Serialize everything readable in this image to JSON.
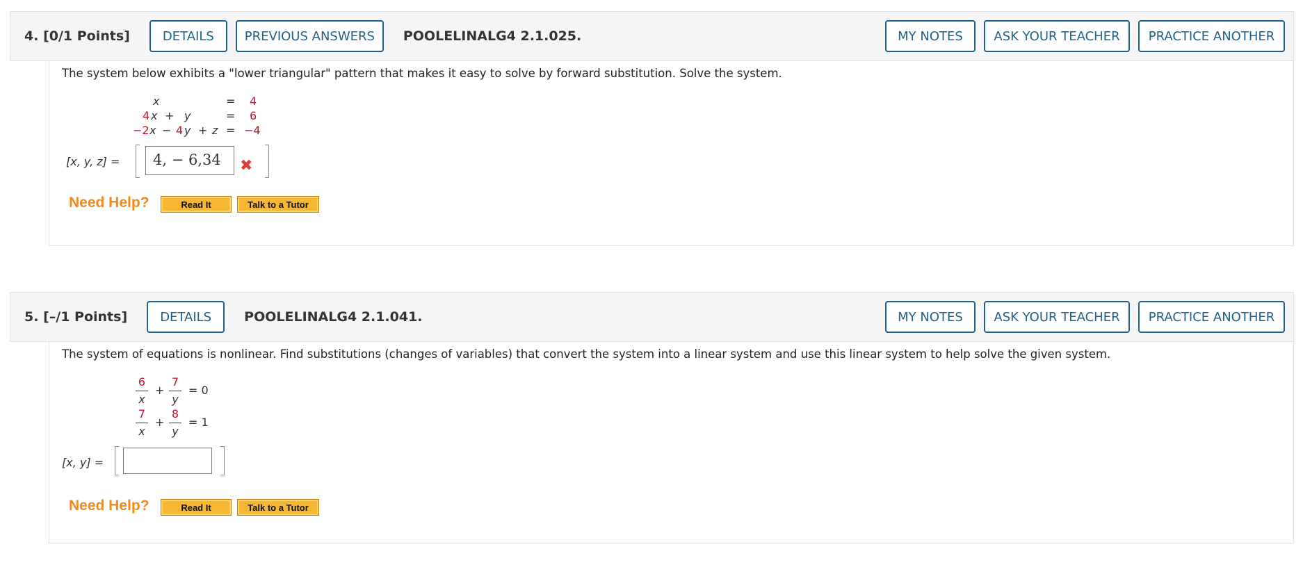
{
  "q4": {
    "number": "4.",
    "points": "[0/1 Points]",
    "details_label": "DETAILS",
    "previous_answers_label": "PREVIOUS ANSWERS",
    "code": "POOLELINALG4 2.1.025.",
    "my_notes_label": "MY NOTES",
    "ask_teacher_label": "ASK YOUR TEACHER",
    "practice_another_label": "PRACTICE ANOTHER",
    "prompt": "The system below exhibits a \"lower triangular\" pattern that makes it easy to solve by forward substitution. Solve the system.",
    "eq": {
      "r1_x": "x",
      "r1_eq": "=",
      "r1_rhs": "4",
      "r2_coef_x": "4",
      "r2_x": "x",
      "r2_plus": "+",
      "r2_y": "y",
      "r2_eq": "=",
      "r2_rhs": "6",
      "r3_coef_x": "−2",
      "r3_x": "x",
      "r3_minus": "−",
      "r3_coef_y": "4",
      "r3_y": "y",
      "r3_plus": "+",
      "r3_z": "z",
      "r3_eq": "=",
      "r3_rhs": "−4"
    },
    "answer_label": "[x, y, z] =",
    "answer_value": "4, − 6,34",
    "answer_status": "incorrect",
    "need_help_label": "Need Help?",
    "read_it_label": "Read It",
    "talk_tutor_label": "Talk to a Tutor"
  },
  "q5": {
    "number": "5.",
    "points": "[–/1 Points]",
    "details_label": "DETAILS",
    "code": "POOLELINALG4 2.1.041.",
    "my_notes_label": "MY NOTES",
    "ask_teacher_label": "ASK YOUR TEACHER",
    "practice_another_label": "PRACTICE ANOTHER",
    "prompt": "The system of equations is nonlinear. Find substitutions (changes of variables) that convert the system into a linear system and use this linear system to help solve the given system.",
    "eq": {
      "r1_num1": "6",
      "r1_den1": "x",
      "r1_plus": "+",
      "r1_num2": "7",
      "r1_den2": "y",
      "r1_eq": "= 0",
      "r2_num1": "7",
      "r2_den1": "x",
      "r2_plus": "+",
      "r2_num2": "8",
      "r2_den2": "y",
      "r2_eq": "= 1"
    },
    "answer_label": "[x, y] =",
    "answer_value": "",
    "need_help_label": "Need Help?",
    "read_it_label": "Read It",
    "talk_tutor_label": "Talk to a Tutor"
  },
  "colors": {
    "button_border": "#1f5f8b",
    "red_coefficient": "#c8102e",
    "need_help": "#f08a1e",
    "orange_button": "#f7b733",
    "incorrect_mark": "#e03a3a"
  },
  "icons": {
    "incorrect": "x-mark-icon"
  }
}
